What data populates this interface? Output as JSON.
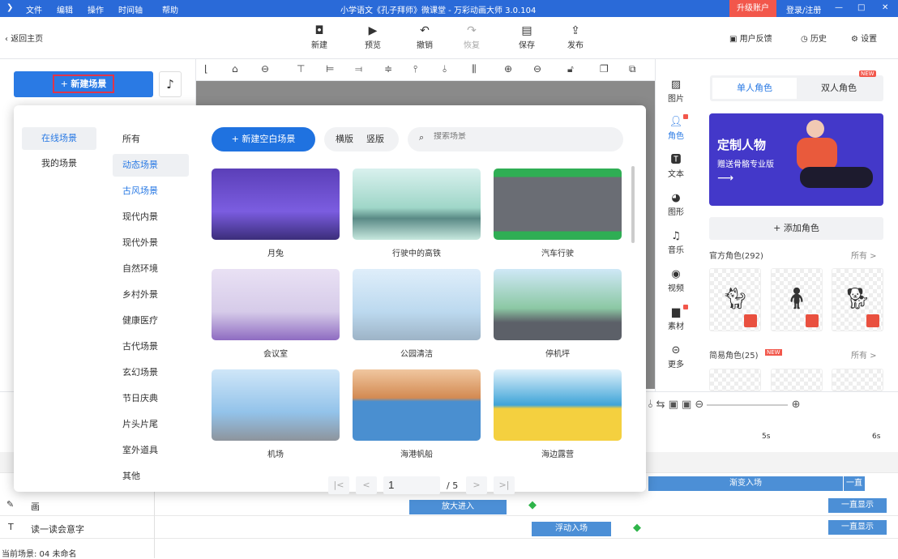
{
  "titlebar": {
    "menus": [
      "文件",
      "编辑",
      "操作",
      "时间轴",
      "帮助"
    ],
    "title": "小学语文《孔子拜师》微课堂 - 万彩动画大师 3.0.104",
    "upgrade": "升级账户",
    "login": "登录/注册",
    "min": "—",
    "max": "□",
    "close": "✕",
    "color": "#2a6ad8"
  },
  "toolbar": {
    "back": "返回主页",
    "items": [
      {
        "label": "新建",
        "icon": "new-icon"
      },
      {
        "label": "预览",
        "icon": "play-icon"
      },
      {
        "label": "撤销",
        "icon": "undo-icon"
      },
      {
        "label": "恢复",
        "icon": "redo-icon"
      },
      {
        "label": "保存",
        "icon": "save-icon"
      },
      {
        "label": "发布",
        "icon": "publish-icon"
      }
    ],
    "feedback": "用户反馈",
    "history": "历史",
    "settings": "设置"
  },
  "left": {
    "new_scene": "新建场景"
  },
  "dialog": {
    "sources": [
      "在线场景",
      "我的场景"
    ],
    "categories": [
      "所有",
      "动态场景",
      "古风场景",
      "现代内景",
      "现代外景",
      "自然环境",
      "乡村外景",
      "健康医疗",
      "古代场景",
      "玄幻场景",
      "节日庆典",
      "片头片尾",
      "室外道具",
      "其他"
    ],
    "new_blank": "新建空白场景",
    "orient": [
      "横版",
      "竖版"
    ],
    "search_placeholder": "搜索场景",
    "scenes": [
      "月兔",
      "行驶中的高铁",
      "汽车行驶",
      "会议室",
      "公园清洁",
      "停机坪",
      "机场",
      "海港帆船",
      "海边露营"
    ],
    "pagination": {
      "first": "|<",
      "prev": "<",
      "page": "1",
      "total": "/ 5",
      "next": ">",
      "last": ">|"
    }
  },
  "rightbar": {
    "items": [
      "图片",
      "角色",
      "文本",
      "图形",
      "音乐",
      "视频",
      "素材",
      "更多"
    ]
  },
  "rpanel": {
    "tabs": [
      "单人角色",
      "双人角色"
    ],
    "new_badge": "NEW",
    "banner_title": "定制人物",
    "banner_sub": "赠送骨骼专业版",
    "add_role": "+ 添加角色",
    "official": "官方角色(292)",
    "simple": "简易角色(25)",
    "all": "所有 >"
  },
  "timeline": {
    "ticks": [
      "5s",
      "6s"
    ],
    "rows": [
      {
        "name": "画"
      },
      {
        "name": "读一读会意字"
      }
    ],
    "bars": [
      "渐变入场",
      "一直显示",
      "放大进入",
      "一直显示",
      "浮动入场",
      "一直显示"
    ],
    "status": "当前场景: 04   未命名"
  }
}
